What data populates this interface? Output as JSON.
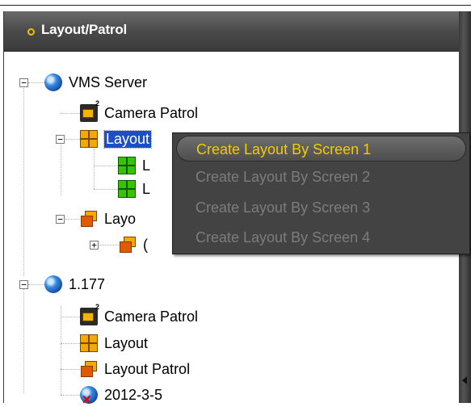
{
  "panel": {
    "title": "Layout/Patrol"
  },
  "tree": {
    "server1": {
      "name": "VMS Server",
      "children": {
        "camera_patrol": "Camera Patrol",
        "layout": "Layout",
        "layout_child1": "L",
        "layout_child2": "L",
        "layout_patrol": "Layo",
        "layout_patrol_child": "("
      }
    },
    "server2": {
      "name": "1.177",
      "children": {
        "camera_patrol": "Camera Patrol",
        "layout": "Layout",
        "layout_patrol": "Layout Patrol",
        "item": "2012-3-5"
      }
    },
    "expander_collapse": "−",
    "expander_expand": "+"
  },
  "context_menu": {
    "items": [
      {
        "label": "Create Layout By Screen 1",
        "enabled": true
      },
      {
        "label": "Create Layout By Screen 2",
        "enabled": false
      },
      {
        "label": "Create Layout By Screen 3",
        "enabled": false
      },
      {
        "label": "Create Layout By Screen 4",
        "enabled": false
      }
    ]
  },
  "colors": {
    "header_bg": "#4a4a4a",
    "header_dot": "#f0c000",
    "selection": "#1d4fc4",
    "menu_bg": "#434343",
    "menu_highlight_text": "#f2cc00",
    "menu_disabled_text": "#7c7c7c"
  },
  "icons": {
    "server": "globe-icon",
    "camera_patrol": "camera-patrol-icon",
    "layout": "layout-grid-icon",
    "layout_item": "layout-grid-green-icon",
    "layout_patrol": "layout-patrol-icon",
    "offline_device": "globe-offline-icon"
  }
}
